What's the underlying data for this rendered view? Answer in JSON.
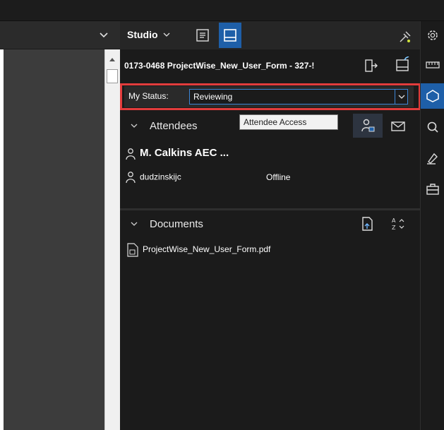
{
  "studio": {
    "title": "Studio",
    "session_title": "0173-0468 ProjectWise_New_User_Form - 327-!"
  },
  "status": {
    "label": "My Status:",
    "value": "Reviewing"
  },
  "attendees": {
    "section_label": "Attendees",
    "tooltip": "Attendee Access",
    "list": [
      {
        "name": "M. Calkins AEC ...",
        "state": ""
      },
      {
        "name": "dudzinskijc",
        "state": "Offline"
      }
    ]
  },
  "documents": {
    "section_label": "Documents",
    "files": [
      "ProjectWise_New_User_Form.pdf"
    ]
  },
  "colors": {
    "accent": "#1e5fa8",
    "highlight": "#e23c3c",
    "panel_bg": "#1b1b1b"
  },
  "icons": [
    "chevron-down-icon",
    "list-icon",
    "markup-panel-icon",
    "plug-icon",
    "gear-icon",
    "exit-icon",
    "checkin-icon",
    "ruler-icon",
    "shapes-icon",
    "search-icon",
    "pen-icon",
    "toolbox-icon",
    "person-lock-icon",
    "mail-icon",
    "person-icon",
    "upload-doc-icon",
    "sort-icon",
    "pdf-file-icon"
  ]
}
